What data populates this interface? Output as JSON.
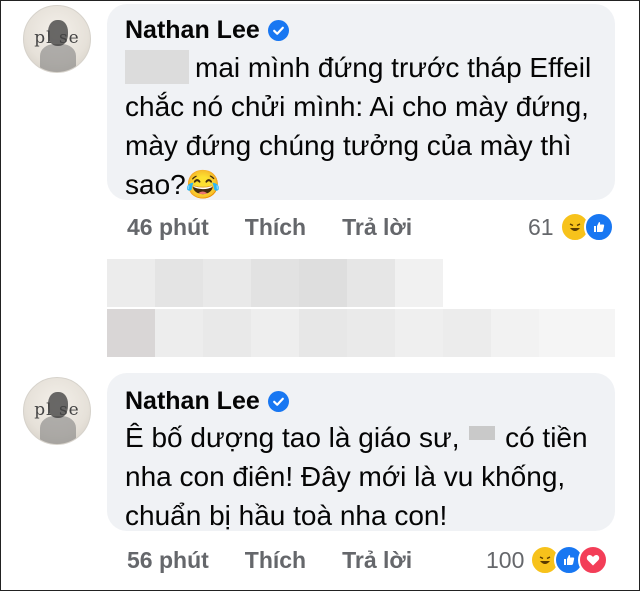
{
  "comments": [
    {
      "author": "Nathan Lee",
      "avatar_text": "pl se",
      "lines": [
        "mai mình đứng trước tháp Effeil",
        "chắc nó chửi mình: Ai cho mày đứng,",
        "mày đứng chúng tưởng của mày thì",
        "sao?😂"
      ],
      "time": "46 phút",
      "like_label": "Thích",
      "reply_label": "Trả lời",
      "reaction_count": "61",
      "reactions": [
        "haha-icon",
        "like-icon"
      ]
    },
    {
      "author": "Nathan Lee",
      "avatar_text": "pl se",
      "line1_before": "Ê bố dượng tao là giáo sư,",
      "line1_after": "có tiền",
      "line2": "nha con điên! Đây mới là vu khống,",
      "line3": "chuẩn bị hầu toà nha con!",
      "time": "56 phút",
      "like_label": "Thích",
      "reply_label": "Trả lời",
      "reaction_count": "100",
      "reactions": [
        "haha-icon",
        "like-icon",
        "love-icon"
      ]
    }
  ],
  "colors": {
    "verified": "#1877f2",
    "bubble": "#f0f2f5",
    "meta": "#65676b"
  }
}
